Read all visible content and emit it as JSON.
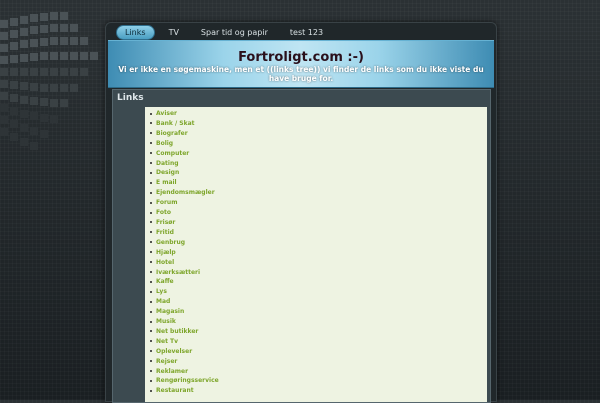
{
  "site": {
    "title": "Fortroligt.com :-)",
    "slogan": "Vi er ikke en søgemaskine, men et ((links tree)) vi finder de links som du ikke viste du have bruge for."
  },
  "nav": {
    "items": [
      {
        "label": "Links",
        "active": true
      },
      {
        "label": "TV",
        "active": false
      },
      {
        "label": "Spar tid og papir",
        "active": false
      },
      {
        "label": "test 123",
        "active": false
      }
    ]
  },
  "panel": {
    "title": "Links",
    "links": [
      "Aviser",
      "Bank / Skat",
      "Biografer",
      "Bolig",
      "Computer",
      "Dating",
      "Design",
      "E mail",
      "Ejendomsmægler",
      "Forum",
      "Foto",
      "Frisør",
      "Fritid",
      "Genbrug",
      "Hjælp",
      "Hotel",
      "Iværksætteri",
      "Kaffe",
      "Lys",
      "Mad",
      "Magasin",
      "Musik",
      "Net butikker",
      "Net Tv",
      "Oplevelser",
      "Rejser",
      "Reklamer",
      "Rengøringsservice",
      "Restaurant"
    ]
  },
  "colors": {
    "accent": "#4a9ec2",
    "link": "#7da52a",
    "title": "#2a0f1b"
  }
}
